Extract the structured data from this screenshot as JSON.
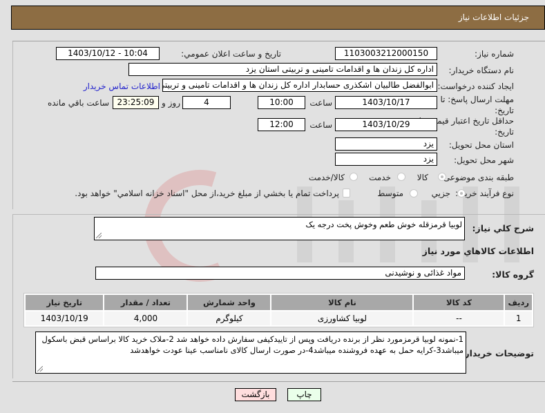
{
  "header": {
    "title": "جزئيات اطلاعات نياز"
  },
  "form": {
    "need_number_label": "شماره نياز:",
    "need_number": "1103003212000150",
    "announce_label": "تاريخ و ساعت اعلان عمومي:",
    "announce_value": "1403/10/12 - 10:04",
    "buyer_org_label": "نام دستگاه خريدار:",
    "buyer_org": "اداره کل زندان ها و اقدامات تامینی و تربیتی استان یزد",
    "requester_label": "ايجاد کننده درخواست:",
    "requester": "ابوالفضل  طالبیان اشکذری حسابدار اداره کل زندان ها و اقدامات تامینی و تربیتی",
    "buyer_contact_link": "اطلاعات تماس خريدار",
    "deadline_label": "مهلت ارسال پاسخ: تا تاريخ:",
    "deadline_date": "1403/10/17",
    "time_label": "ساعت",
    "deadline_time": "10:00",
    "days_remaining": "4",
    "days_and_label": "روز و",
    "time_remaining": "23:25:09",
    "time_remaining_label": "ساعت باقي مانده",
    "price_validity_label": "حداقل تاريخ اعتبار قيمت: تا تاريخ:",
    "price_validity_date": "1403/10/29",
    "price_validity_time": "12:00",
    "province_label": "استان محل تحويل:",
    "province": "یزد",
    "city_label": "شهر محل تحويل:",
    "city": "یزد",
    "category_label": "طبقه بندی موضوعی:",
    "category_options": [
      {
        "label": "کالا",
        "checked": true
      },
      {
        "label": "خدمت",
        "checked": false
      },
      {
        "label": "کالا/خدمت",
        "checked": false
      }
    ],
    "purchase_type_label": "نوع فرآيند خريد :",
    "purchase_type_options": [
      {
        "label": "جزيي",
        "checked": true
      },
      {
        "label": "متوسط",
        "checked": false
      }
    ],
    "treasury_checkbox_label": "پرداخت تمام يا بخشي از مبلغ خريد،از محل \"اسناد خزانه اسلامي\" خواهد بود.",
    "treasury_checked": false
  },
  "description": {
    "label": "شرح کلي نياز:",
    "value": "لوبیا قرمزقله خوش طعم وخوش پخت درجه یک"
  },
  "goods_section": {
    "title": "اطلاعات کالاهاي مورد نياز",
    "group_label": "گروه کالا:",
    "group_value": "مواد غذائی و نوشیدنی"
  },
  "items_table": {
    "columns": [
      "رديف",
      "کد کالا",
      "نام کالا",
      "واحد شمارش",
      "تعداد / مقدار",
      "تاريخ نياز"
    ],
    "rows": [
      [
        "1",
        "--",
        "لوبیا کشاورزی",
        "کیلوگرم",
        "4,000",
        "1403/10/19"
      ]
    ]
  },
  "buyer_notes": {
    "label": "توضيحات خريدار:",
    "value": "1-نمونه لوبیا قرمزمورد نظر از برنده دریافت وپس از تاییدکیفی سفارش داده خواهد شد 2-ملاک خرید کالا  براساس قبض باسکول میباشد3-کرایه حمل به عهده فروشنده میباشد4-در صورت ارسال کالای نامناسب عینا عودت خواهدشد"
  },
  "buttons": {
    "print": "چاپ",
    "back": "بازگشت"
  },
  "colors": {
    "header_bg": "#8d6d43",
    "print_bg": "#eaffea",
    "back_bg": "#ffdede",
    "link": "#2222cc"
  }
}
